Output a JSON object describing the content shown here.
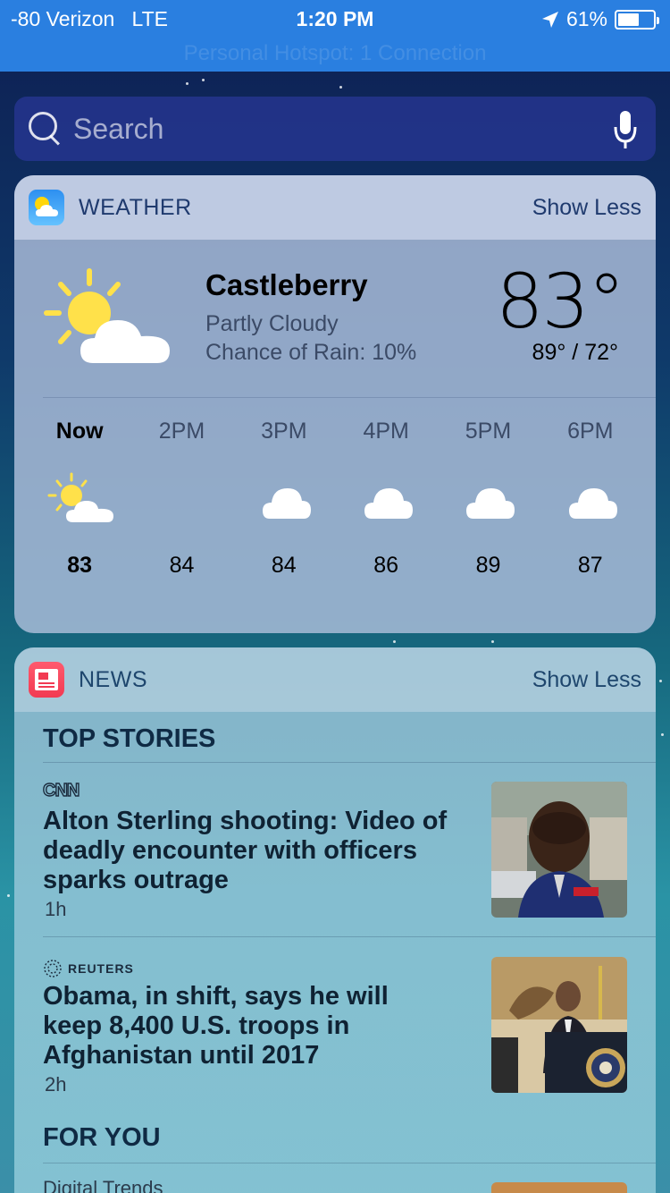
{
  "status_bar": {
    "carrier": "-80 Verizon",
    "network": "LTE",
    "time": "1:20 PM",
    "battery": "61%",
    "battery_level": 0.61,
    "hotspot": "Personal Hotspot: 1 Connection"
  },
  "search": {
    "placeholder": "Search"
  },
  "weather": {
    "title": "WEATHER",
    "toggle": "Show Less",
    "city": "Castleberry",
    "condition": "Partly Cloudy",
    "rain": "Chance of Rain: 10%",
    "temp": "83°",
    "hilo": "89° / 72°",
    "hourly": [
      {
        "label": "Now",
        "icon": "partly-sunny-icon",
        "temp": "83"
      },
      {
        "label": "2PM",
        "icon": "",
        "temp": "84"
      },
      {
        "label": "3PM",
        "icon": "cloud-icon",
        "temp": "84"
      },
      {
        "label": "4PM",
        "icon": "cloud-icon",
        "temp": "86"
      },
      {
        "label": "5PM",
        "icon": "cloud-icon",
        "temp": "89"
      },
      {
        "label": "6PM",
        "icon": "cloud-icon",
        "temp": "87"
      }
    ]
  },
  "news": {
    "title": "NEWS",
    "toggle": "Show Less",
    "top_stories_label": "TOP STORIES",
    "stories": [
      {
        "source": "CNN",
        "title": "Alton Sterling shooting: Video of deadly encounter with officers sparks outrage",
        "age": "1h"
      },
      {
        "source": "REUTERS",
        "title": "Obama, in shift, says he will keep 8,400 U.S. troops in Afghanistan until 2017",
        "age": "2h"
      }
    ],
    "for_you_label": "FOR YOU",
    "for_you_source": "Digital Trends"
  }
}
